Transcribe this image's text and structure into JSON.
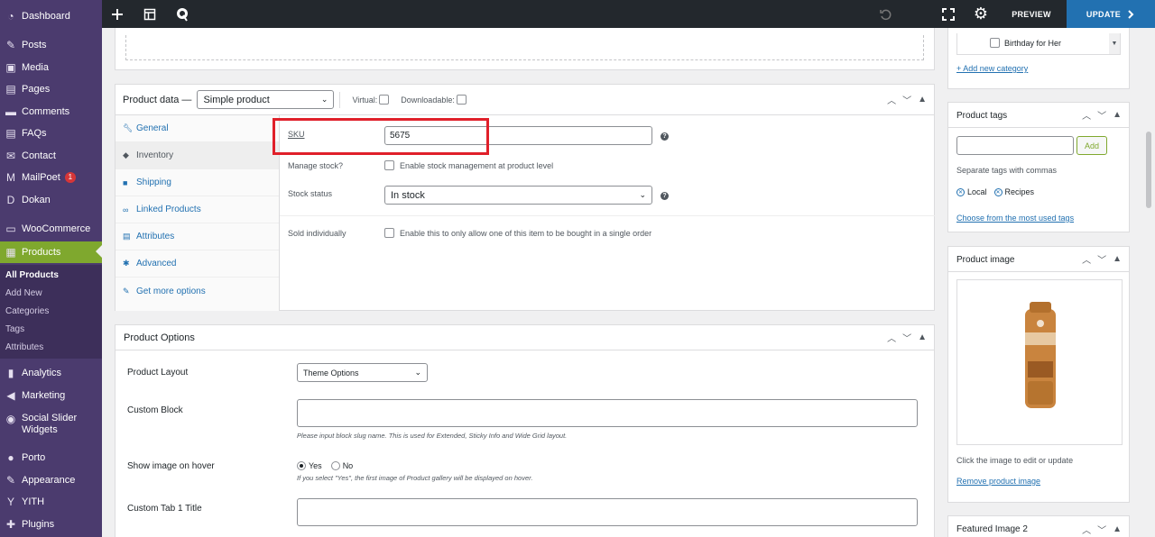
{
  "sidebar": {
    "items": [
      {
        "label": "Dashboard",
        "icon": "dashboard-icon",
        "glyph": "◔"
      },
      {
        "label": "Posts",
        "icon": "pin-icon",
        "glyph": "✎"
      },
      {
        "label": "Media",
        "icon": "media-icon",
        "glyph": "▣"
      },
      {
        "label": "Pages",
        "icon": "pages-icon",
        "glyph": "▤"
      },
      {
        "label": "Comments",
        "icon": "comment-icon",
        "glyph": "▬"
      },
      {
        "label": "FAQs",
        "icon": "faq-icon",
        "glyph": "▤"
      },
      {
        "label": "Contact",
        "icon": "mail-icon",
        "glyph": "✉"
      },
      {
        "label": "MailPoet",
        "icon": "mailpoet-icon",
        "glyph": "M",
        "badge": "1"
      },
      {
        "label": "Dokan",
        "icon": "dokan-icon",
        "glyph": "D"
      },
      {
        "label": "WooCommerce",
        "icon": "woo-icon",
        "glyph": "▭"
      },
      {
        "label": "Products",
        "icon": "products-icon",
        "glyph": "▦"
      }
    ],
    "submenu": [
      "All Products",
      "Add New",
      "Categories",
      "Tags",
      "Attributes"
    ],
    "items_after": [
      {
        "label": "Analytics",
        "icon": "analytics-icon",
        "glyph": "▮"
      },
      {
        "label": "Marketing",
        "icon": "megaphone-icon",
        "glyph": "◀"
      },
      {
        "label": "Social Slider Widgets",
        "icon": "social-icon",
        "glyph": "◉"
      },
      {
        "label": "Porto",
        "icon": "porto-icon",
        "glyph": "●"
      },
      {
        "label": "Appearance",
        "icon": "brush-icon",
        "glyph": "✎"
      },
      {
        "label": "YITH",
        "icon": "yith-icon",
        "glyph": "Y"
      },
      {
        "label": "Plugins",
        "icon": "plugin-icon",
        "glyph": "✚"
      }
    ]
  },
  "topbar": {
    "preview": "PREVIEW",
    "update": "UPDATE"
  },
  "product_data": {
    "title": "Product data —",
    "type": "Simple product",
    "virtual_label": "Virtual:",
    "downloadable_label": "Downloadable:",
    "tabs": [
      "General",
      "Inventory",
      "Shipping",
      "Linked Products",
      "Attributes",
      "Advanced",
      "Get more options"
    ],
    "sku_label": "SKU",
    "sku_value": "5675",
    "manage_stock_label": "Manage stock?",
    "manage_stock_text": "Enable stock management at product level",
    "stock_status_label": "Stock status",
    "stock_status_value": "In stock",
    "sold_individually_label": "Sold individually",
    "sold_individually_text": "Enable this to only allow one of this item to be bought in a single order",
    "help": "?"
  },
  "product_options": {
    "title": "Product Options",
    "layout_label": "Product Layout",
    "layout_value": "Theme Options",
    "custom_block_label": "Custom Block",
    "custom_block_note": "Please input block slug name. This is used for Extended, Sticky Info and Wide Grid layout.",
    "hover_label": "Show image on hover",
    "yes": "Yes",
    "no": "No",
    "hover_note": "If you select \"Yes\", the first image of Product gallery will be displayed on hover.",
    "tab1_label": "Custom Tab 1 Title"
  },
  "categories": {
    "item": "Birthday for Her",
    "add_new": "+ Add new category"
  },
  "tags": {
    "title": "Product tags",
    "add": "Add",
    "hint": "Separate tags with commas",
    "tag1": "Local",
    "tag2": "Recipes",
    "choose": "Choose from the most used tags"
  },
  "image": {
    "title": "Product image",
    "hint": "Click the image to edit or update",
    "remove": "Remove product image"
  },
  "featured": {
    "title": "Featured Image 2"
  },
  "colors": {
    "sidebar": "#4b3b6e",
    "active": "#7fa82e",
    "highlight": "#e0202a",
    "link": "#2271b1"
  }
}
